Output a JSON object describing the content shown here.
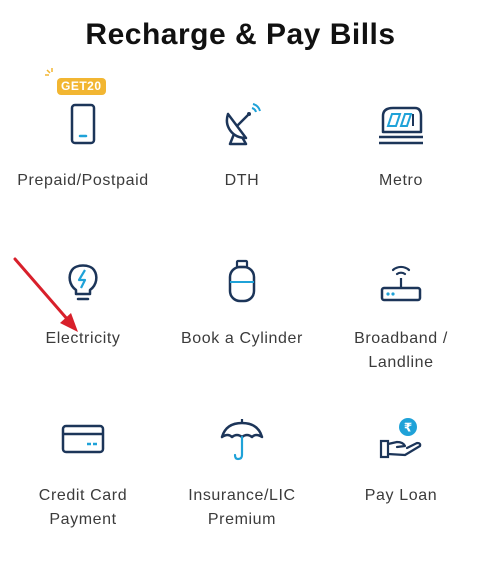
{
  "page": {
    "title": "Recharge & Pay Bills"
  },
  "colors": {
    "icon_navy": "#1c3559",
    "icon_accent": "#1fa2d8",
    "badge": "#f2b632",
    "arrow": "#d8202b"
  },
  "offer_badge": {
    "text": "GET20"
  },
  "tiles": [
    {
      "label": "Prepaid/Postpaid",
      "icon": "mobile-phone-icon"
    },
    {
      "label": "DTH",
      "icon": "satellite-dish-icon"
    },
    {
      "label": "Metro",
      "icon": "metro-train-icon"
    },
    {
      "label": "Electricity",
      "icon": "light-bulb-icon"
    },
    {
      "label": "Book a Cylinder",
      "icon": "gas-cylinder-icon"
    },
    {
      "label": "Broadband /",
      "label2": "Landline",
      "icon": "router-icon"
    },
    {
      "label": "Credit Card",
      "label2": "Payment",
      "icon": "credit-card-icon"
    },
    {
      "label": "Insurance/LIC",
      "label2": "Premium",
      "icon": "umbrella-icon"
    },
    {
      "label": "Pay Loan",
      "icon": "rupee-hand-icon"
    }
  ]
}
